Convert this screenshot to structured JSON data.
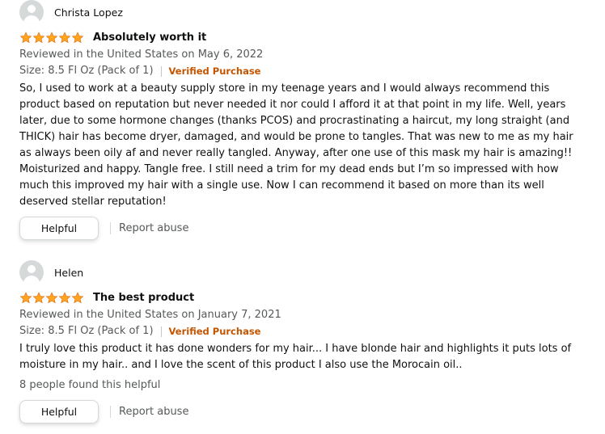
{
  "colors": {
    "star": "#ffa41c",
    "verified": "#c45500",
    "secondary_text": "#565959",
    "primary_text": "#0f1111"
  },
  "reviews": [
    {
      "profile_name": "Christa Lopez",
      "rating": 5,
      "title": "Absolutely worth it",
      "date": "Reviewed in the United States on May 6, 2022",
      "format": "Size: 8.5 Fl Oz (Pack of 1)",
      "verified": "Verified Purchase",
      "body": "So, I used to work at a beauty supply store in my teenage years and I would always recommend this product based on reputation but never needed it nor could I afford it at that point in my life. Well, years later, due to some hormone changes (thanks PCOS) and procrastinating a haircut, my long straight (and THICK) hair has become dryer, damaged, and would be prone to tangles. That was new to me as my hair as always been oily af and never really tangled. Anyway, after one use of this mask my hair is amazing!! Moisturized and happy. Tangle free. I still need a trim for my dead ends but I’m so impressed with how much this improved my hair with a single use. Now I can recommend it based on more than its well deserved stellar reputation!",
      "helpful_label": "Helpful",
      "report_label": "Report abuse"
    },
    {
      "profile_name": "Helen",
      "rating": 5,
      "title": "The best product",
      "date": "Reviewed in the United States on January 7, 2021",
      "format": "Size: 8.5 Fl Oz (Pack of 1)",
      "verified": "Verified Purchase",
      "body": "I truly love this product it has done wonders for my hair... I have blonde hair and highlights it puts lots of moisture in my hair.. and I love the scent of this product I also use the Morocain oil..",
      "helpful_count": "8 people found this helpful",
      "helpful_label": "Helpful",
      "report_label": "Report abuse"
    }
  ]
}
